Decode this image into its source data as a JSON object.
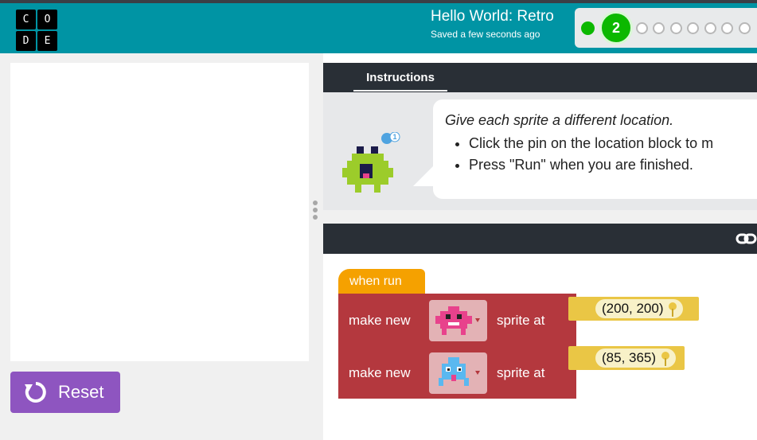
{
  "header": {
    "logo_letters": [
      "C",
      "O",
      "D",
      "E"
    ],
    "title": "Hello World: Retro",
    "saved_status": "Saved a few seconds ago",
    "current_level": "2",
    "level_dots": 7
  },
  "left_panel": {
    "reset_label": "Reset"
  },
  "instructions": {
    "tab_label": "Instructions",
    "hint_count": "1",
    "heading": "Give each sprite a different location.",
    "bullets": [
      "Click the pin on the location block to m",
      "Press \"Run\" when you are finished."
    ]
  },
  "workspace": {
    "hat_label": "when run",
    "blocks": [
      {
        "prefix": "make new",
        "suffix": "sprite at",
        "sprite": "pink-alien-sprite",
        "location": "(200, 200)"
      },
      {
        "prefix": "make new",
        "suffix": "sprite at",
        "sprite": "blue-squid-sprite",
        "location": "(85, 365)"
      }
    ]
  },
  "colors": {
    "header": "#0094a4",
    "progress_green": "#0cb800",
    "reset_purple": "#8e55c0",
    "block_red": "#b4383e",
    "hat_orange": "#f5a100",
    "location_yellow": "#eac645"
  }
}
